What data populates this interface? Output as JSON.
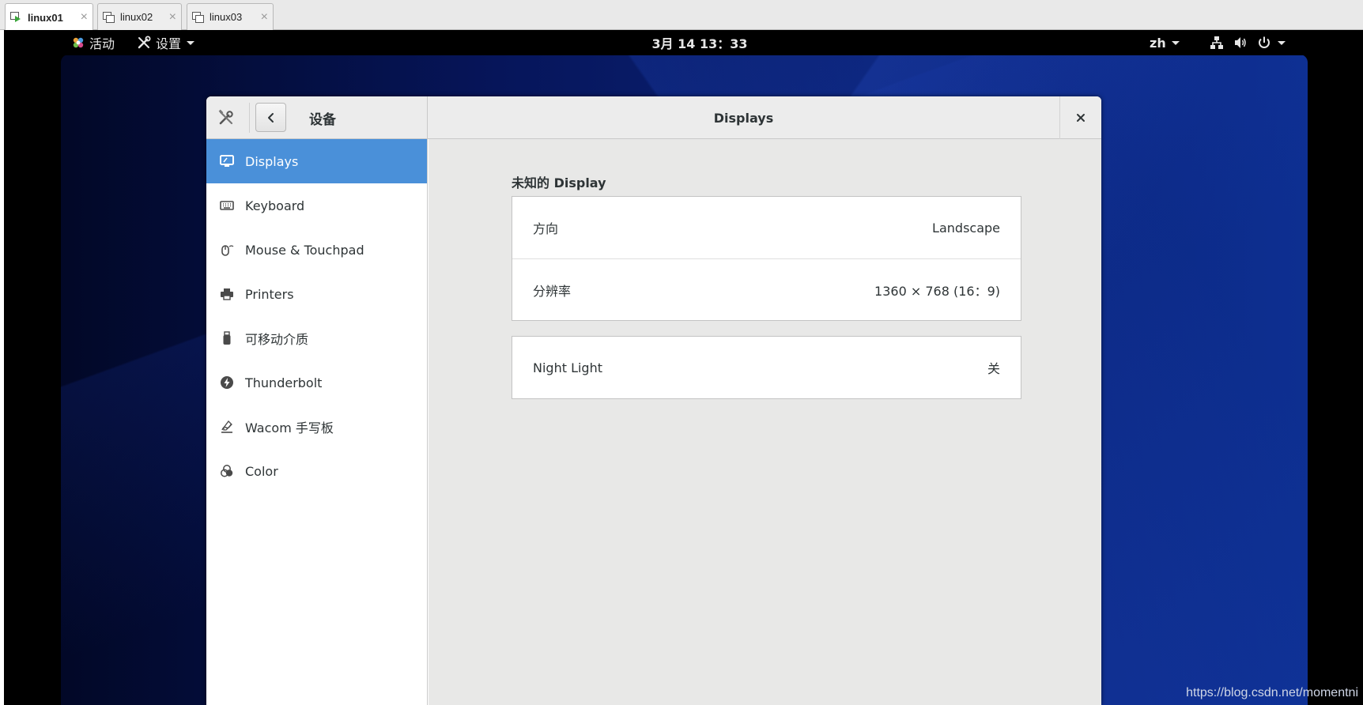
{
  "host_tabs": [
    {
      "label": "linux01",
      "active": true
    },
    {
      "label": "linux02",
      "active": false
    },
    {
      "label": "linux03",
      "active": false
    }
  ],
  "topbar": {
    "activities": "活动",
    "app_menu": "设置",
    "clock": "3月 14  13：33",
    "input_method": "zh",
    "icons": [
      "network-icon",
      "volume-icon",
      "power-icon"
    ]
  },
  "window": {
    "panel_title": "设备",
    "title": "Displays",
    "sidebar": [
      {
        "label": "Displays",
        "icon": "display-icon",
        "selected": true
      },
      {
        "label": "Keyboard",
        "icon": "keyboard-icon"
      },
      {
        "label": "Mouse & Touchpad",
        "icon": "mouse-icon"
      },
      {
        "label": "Printers",
        "icon": "printer-icon"
      },
      {
        "label": "可移动介质",
        "icon": "removable-media-icon"
      },
      {
        "label": "Thunderbolt",
        "icon": "thunderbolt-icon"
      },
      {
        "label": "Wacom 手写板",
        "icon": "tablet-icon"
      },
      {
        "label": "Color",
        "icon": "color-icon"
      }
    ],
    "display": {
      "section_title": "未知的 Display",
      "orientation_label": "方向",
      "orientation_value": "Landscape",
      "resolution_label": "分辨率",
      "resolution_value": "1360 × 768 (16：9)"
    },
    "night_light": {
      "label": "Night Light",
      "value": "关"
    }
  },
  "watermark": "https://blog.csdn.net/momentni",
  "colors": {
    "selection": "#4a90d9",
    "topbar": "#000000",
    "content_bg": "#e8e8e7"
  }
}
